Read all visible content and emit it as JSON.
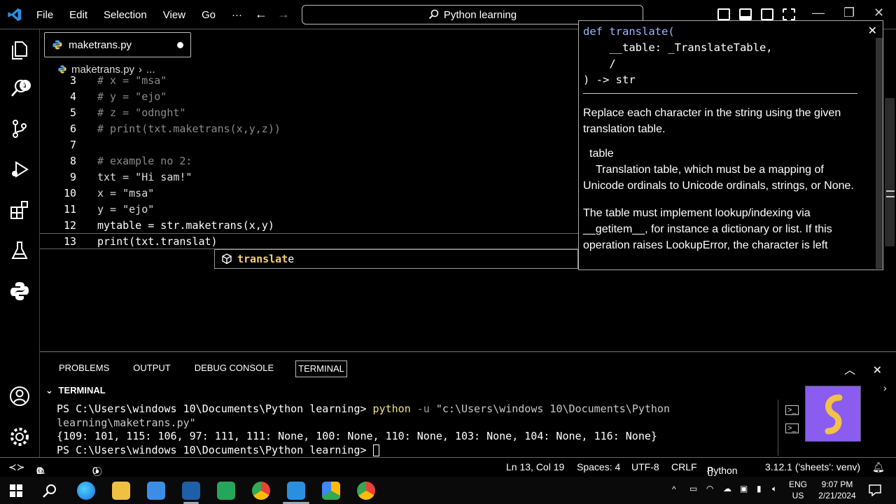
{
  "menu": [
    "File",
    "Edit",
    "Selection",
    "View",
    "Go",
    "···"
  ],
  "command_center": "Python learning",
  "activity_badge": "1",
  "tab": {
    "label": "maketrans.py"
  },
  "breadcrumb": {
    "file": "maketrans.py",
    "sep": "›",
    "more": "..."
  },
  "editor_lines": [
    {
      "n": "3",
      "text": "# x = \"msa\"",
      "kind": "comment"
    },
    {
      "n": "4",
      "text": "# y = \"ejo\"",
      "kind": "comment"
    },
    {
      "n": "5",
      "text": "# z = \"odnght\"",
      "kind": "comment"
    },
    {
      "n": "6",
      "text": "# print(txt.maketrans(x,y,z))",
      "kind": "comment"
    },
    {
      "n": "7",
      "text": "",
      "kind": "blank"
    },
    {
      "n": "8",
      "text": "# example no 2:",
      "kind": "comment"
    },
    {
      "n": "9",
      "text": "txt = \"Hi sam!\"",
      "kind": "code"
    },
    {
      "n": "10",
      "text": "x = \"msa\"",
      "kind": "code"
    },
    {
      "n": "11",
      "text": "y = \"ejo\"",
      "kind": "code"
    },
    {
      "n": "12",
      "text": "mytable = str.maketrans(x,y)",
      "kind": "code"
    },
    {
      "n": "13",
      "text": "print(txt.translat)",
      "kind": "code"
    }
  ],
  "suggest": {
    "match": "translat",
    "rest": "e"
  },
  "hover": {
    "sig_lines": [
      "def translate(",
      "    __table: _TranslateTable,",
      "    /",
      ") -> str"
    ],
    "doc1": "Replace each character in the string using the given translation table.",
    "param_name": "table",
    "param_desc": "Translation table, which must be a mapping of Unicode ordinals to Unicode ordinals, strings, or None.",
    "doc2": "The table must implement lookup/indexing via __getitem__, for instance a dictionary or list. If this operation raises LookupError, the character is left"
  },
  "panel": {
    "tabs": [
      "PROBLEMS",
      "OUTPUT",
      "DEBUG CONSOLE",
      "TERMINAL"
    ],
    "active_tab": "TERMINAL",
    "section_title": "TERMINAL",
    "prompt1": "PS C:\\Users\\windows 10\\Documents\\Python learning> ",
    "cmd": "python",
    "flag": " -u ",
    "path": "\"c:\\Users\\windows 10\\Documents\\Python learning\\maketrans.py\"",
    "output": "{109: 101, 115: 106, 97: 111, 111: None, 100: None, 110: None, 103: None, 104: None, 116: None}",
    "prompt2": "PS C:\\Users\\windows 10\\Documents\\Python learning> "
  },
  "status": {
    "errors": "0",
    "warnings": "0",
    "ports": "0",
    "position": "Ln 13, Col 19",
    "spaces": "Spaces: 4",
    "encoding": "UTF-8",
    "eol": "CRLF",
    "language": "Python",
    "interpreter": "3.12.1 ('sheets': venv)"
  },
  "taskbar": {
    "lang1": "ENG",
    "lang2": "US",
    "time": "9:07 PM",
    "date": "2/21/2024"
  },
  "colors": {
    "accent": "#8a5cf0",
    "suggest_highlight": "#f5d36b",
    "terminal_cmd": "#f2e27a"
  }
}
